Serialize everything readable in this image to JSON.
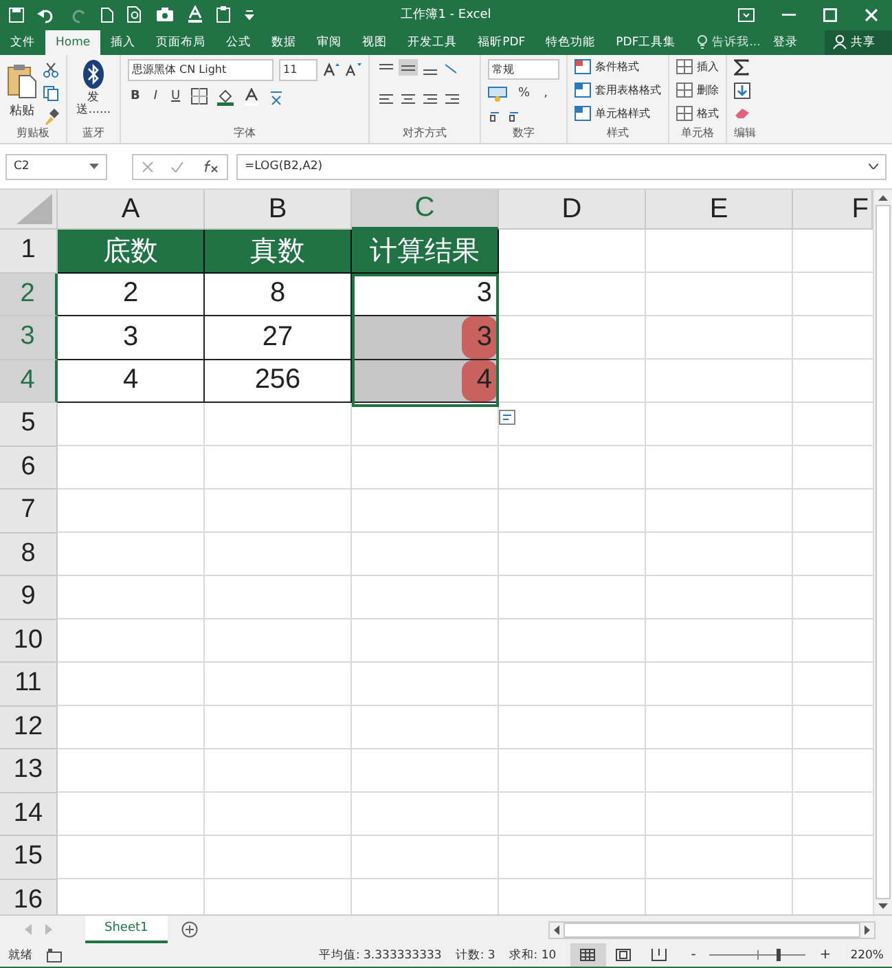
{
  "window": {
    "title": "工作簿1 - Excel"
  },
  "menu_tabs": [
    {
      "label": "文件",
      "selected": false
    },
    {
      "label": "Home",
      "selected": true
    },
    {
      "label": "插入",
      "selected": false
    },
    {
      "label": "页面布局",
      "selected": false
    },
    {
      "label": "公式",
      "selected": false
    },
    {
      "label": "数据",
      "selected": false
    },
    {
      "label": "审阅",
      "selected": false
    },
    {
      "label": "视图",
      "selected": false
    },
    {
      "label": "开发工具",
      "selected": false
    },
    {
      "label": "福昕PDF",
      "selected": false
    },
    {
      "label": "特色功能",
      "selected": false
    },
    {
      "label": "PDF工具集",
      "selected": false
    }
  ],
  "tell_me": "告诉我...",
  "sign_in": "登录",
  "share": "共享",
  "clipboard": {
    "paste": "粘贴",
    "label": "剪贴板"
  },
  "bluetooth": {
    "send": "发送......",
    "label": "蓝牙"
  },
  "font": {
    "name": "思源黑体 CN Light",
    "size": "11",
    "bold": "B",
    "italic": "I",
    "underline": "U",
    "label": "字体"
  },
  "alignment": {
    "label": "对齐方式"
  },
  "number": {
    "format": "常规",
    "percent": "%",
    "comma": ",",
    "label": "数字"
  },
  "styles": {
    "items": [
      "条件格式",
      "套用表格格式",
      "单元格样式"
    ],
    "label": "样式"
  },
  "cells_group": {
    "items": [
      "插入",
      "删除",
      "格式"
    ],
    "label": "单元格"
  },
  "editing": {
    "label": "编辑"
  },
  "formula_bar": {
    "name_box": "C2",
    "formula": "=LOG(B2,A2)"
  },
  "sheet": {
    "columns": [
      {
        "label": "A",
        "selected": false
      },
      {
        "label": "B",
        "selected": false
      },
      {
        "label": "C",
        "selected": true
      },
      {
        "label": "D",
        "selected": false
      },
      {
        "label": "E",
        "selected": false
      },
      {
        "label": "F",
        "selected": false
      }
    ],
    "rows": [
      {
        "label": "1",
        "selected": false,
        "kind": "header",
        "cells": [
          {
            "value": "底数"
          },
          {
            "value": "真数"
          },
          {
            "value": "计算结果"
          }
        ]
      },
      {
        "label": "2",
        "selected": true,
        "kind": "data",
        "cells": [
          {
            "value": "2",
            "selected": false,
            "highlighted": false
          },
          {
            "value": "8",
            "selected": false,
            "highlighted": false
          },
          {
            "value": "3",
            "selected": false,
            "highlighted": false
          }
        ]
      },
      {
        "label": "3",
        "selected": true,
        "kind": "data",
        "cells": [
          {
            "value": "3",
            "selected": false,
            "highlighted": false
          },
          {
            "value": "27",
            "selected": false,
            "highlighted": false
          },
          {
            "value": "3",
            "selected": true,
            "highlighted": true
          }
        ]
      },
      {
        "label": "4",
        "selected": true,
        "kind": "data",
        "cells": [
          {
            "value": "4",
            "selected": false,
            "highlighted": false
          },
          {
            "value": "256",
            "selected": false,
            "highlighted": false
          },
          {
            "value": "4",
            "selected": true,
            "highlighted": true
          }
        ]
      },
      {
        "label": "5",
        "selected": false,
        "kind": "empty"
      },
      {
        "label": "6",
        "selected": false,
        "kind": "empty"
      },
      {
        "label": "7",
        "selected": false,
        "kind": "empty"
      },
      {
        "label": "8",
        "selected": false,
        "kind": "empty"
      },
      {
        "label": "9",
        "selected": false,
        "kind": "empty"
      },
      {
        "label": "10",
        "selected": false,
        "kind": "empty"
      },
      {
        "label": "11",
        "selected": false,
        "kind": "empty"
      },
      {
        "label": "12",
        "selected": false,
        "kind": "empty"
      },
      {
        "label": "13",
        "selected": false,
        "kind": "empty"
      },
      {
        "label": "14",
        "selected": false,
        "kind": "empty"
      },
      {
        "label": "15",
        "selected": false,
        "kind": "empty"
      },
      {
        "label": "16",
        "selected": false,
        "kind": "empty"
      }
    ]
  },
  "sheet_tabs": [
    {
      "label": "Sheet1",
      "selected": true
    }
  ],
  "status_bar": {
    "ready": "就绪",
    "average": "平均值: 3.333333333",
    "count": "计数: 3",
    "sum": "求和: 10",
    "zoom": "220%",
    "zoom_out": "-",
    "zoom_in": "+",
    "zoom_slider": {
      "level": 0.72
    }
  }
}
